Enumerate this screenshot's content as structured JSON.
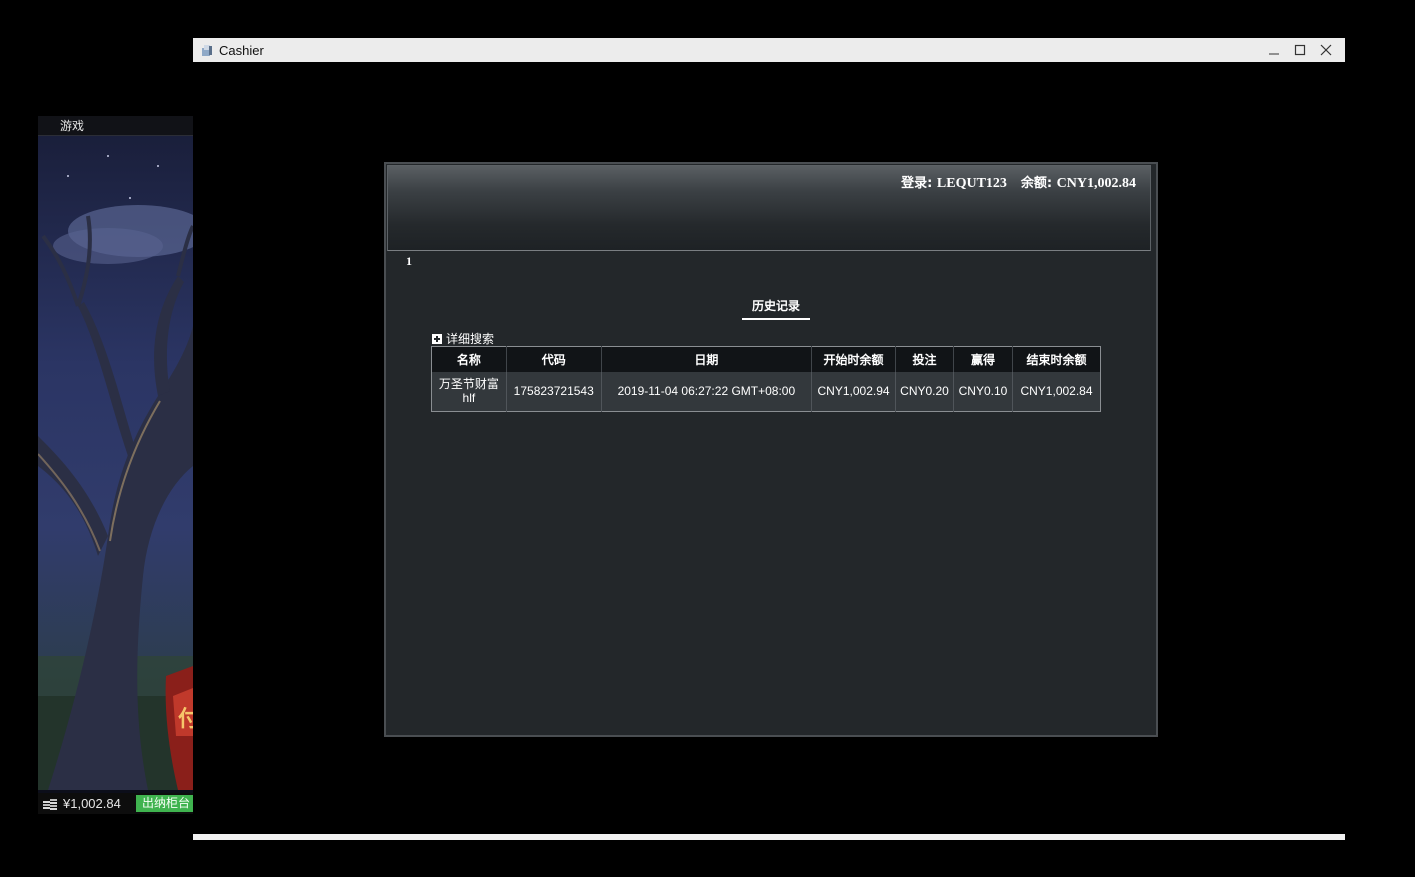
{
  "game_window": {
    "title": "游戏",
    "balance": "¥1,002.84",
    "cashier_button": "出纳柜台"
  },
  "cashier_window": {
    "title": "Cashier",
    "account": {
      "login_label": "登录:",
      "login_value": "LEQUT123",
      "balance_label": "余额:",
      "balance_value": "CNY1,002.84"
    },
    "page_number": "1",
    "section_title": "历史记录",
    "advanced_search": "详细搜索",
    "table": {
      "headers": [
        "名称",
        "代码",
        "日期",
        "开始时余额",
        "投注",
        "赢得",
        "结束时余额"
      ],
      "rows": [
        {
          "name": "万圣节财富hlf",
          "code": "175823721543",
          "date": "2019-11-04 06:27:22 GMT+08:00",
          "start_balance": "CNY1,002.94",
          "bet": "CNY0.20",
          "win": "CNY0.10",
          "end_balance": "CNY1,002.84"
        }
      ]
    }
  }
}
